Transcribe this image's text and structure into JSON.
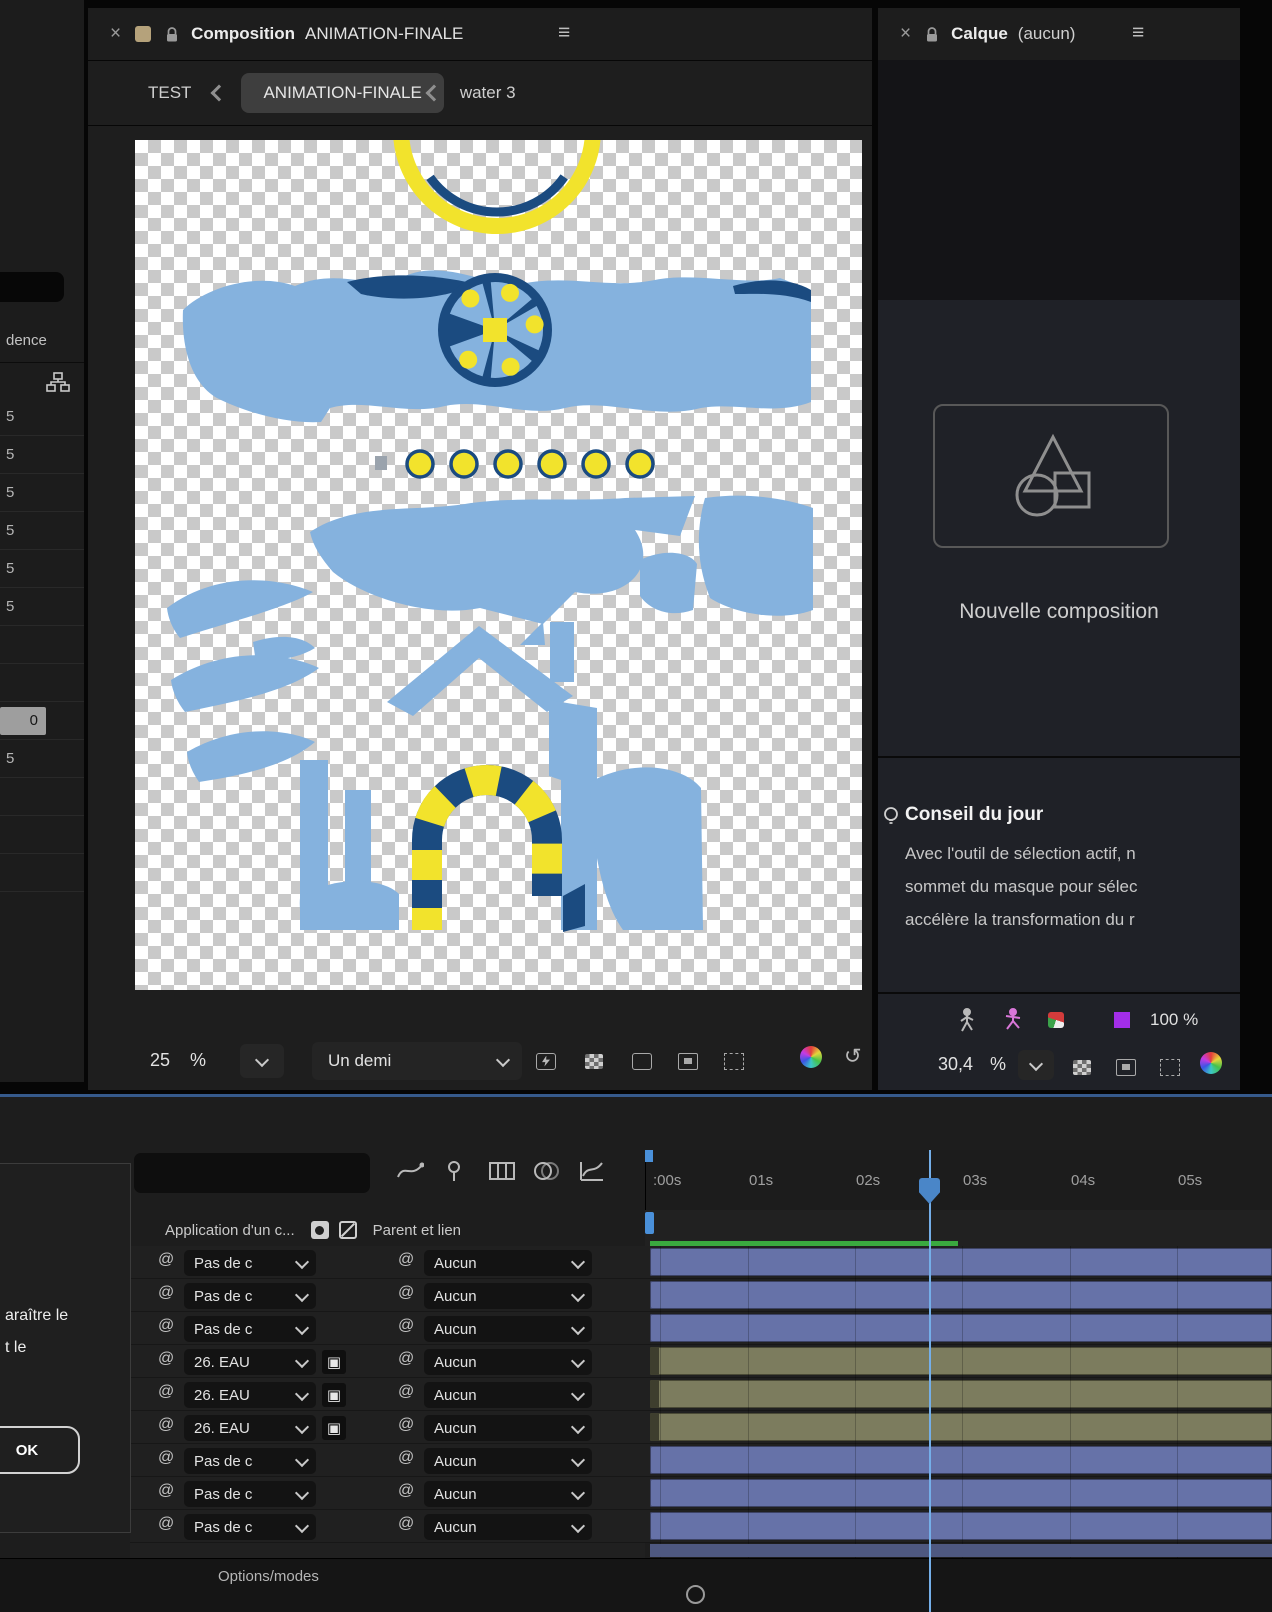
{
  "colors": {
    "art-blue": "#85b2de",
    "art-dark": "#1b4b80",
    "art-yellow": "#f2e32c",
    "bar-blue": "#6672a8",
    "bar-olive": "#7c7c5e",
    "cache-green": "#3aa93f",
    "playhead-blue": "#4a86c8",
    "accent-tan": "#b5a27b"
  },
  "left_strip": {
    "tab_label": "dence",
    "rows": [
      {
        "label": "5"
      },
      {
        "label": "5"
      },
      {
        "label": "5"
      },
      {
        "label": "5"
      },
      {
        "label": "5"
      },
      {
        "label": "5"
      },
      {
        "label": ""
      },
      {
        "label": ""
      },
      {
        "label": "0",
        "highlight": true
      },
      {
        "label": "5"
      },
      {
        "label": ""
      },
      {
        "label": ""
      },
      {
        "label": ""
      }
    ]
  },
  "composition_panel": {
    "tab": {
      "close": "×",
      "title": "Composition",
      "name": "ANIMATION-FINALE",
      "menu": "≡"
    },
    "breadcrumb": {
      "items": [
        "TEST",
        "ANIMATION-FINALE",
        "water 3"
      ]
    },
    "toolbar": {
      "zoom_value": "25",
      "percent": "%",
      "resolution": "Un demi"
    }
  },
  "layer_panel": {
    "tab": {
      "close": "×",
      "title": "Calque",
      "subtitle": "(aucun)",
      "menu": "≡"
    },
    "empty_label": "Nouvelle composition",
    "tip": {
      "heading": "Conseil du jour",
      "lines": [
        "Avec l'outil de sélection actif, n",
        "sommet du masque pour sélec",
        "accélère la transformation du r"
      ]
    },
    "toolbar": {
      "zoom_value": "30,4",
      "percent": "%",
      "preview_zoom": "100 %"
    }
  },
  "dialog": {
    "lines": [
      "araître le",
      "t le"
    ],
    "ok_label": "OK"
  },
  "timeline": {
    "columns": {
      "source": "Application d'un c...",
      "parent": "Parent et lien"
    },
    "ruler_labels": [
      ":00s",
      "01s",
      "02s",
      "03s",
      "04s",
      "05s"
    ],
    "rows": [
      {
        "matte": "Pas de c",
        "parent": "Aucun",
        "bar": "blue",
        "matte_icon": false
      },
      {
        "matte": "Pas de c",
        "parent": "Aucun",
        "bar": "blue",
        "matte_icon": false
      },
      {
        "matte": "Pas de c",
        "parent": "Aucun",
        "bar": "blue",
        "matte_icon": false
      },
      {
        "matte": "26. EAU",
        "parent": "Aucun",
        "bar": "olive",
        "matte_icon": true
      },
      {
        "matte": "26. EAU",
        "parent": "Aucun",
        "bar": "olive",
        "matte_icon": true
      },
      {
        "matte": "26. EAU",
        "parent": "Aucun",
        "bar": "olive",
        "matte_icon": true
      },
      {
        "matte": "Pas de c",
        "parent": "Aucun",
        "bar": "blue",
        "matte_icon": false
      },
      {
        "matte": "Pas de c",
        "parent": "Aucun",
        "bar": "blue",
        "matte_icon": false
      },
      {
        "matte": "Pas de c",
        "parent": "Aucun",
        "bar": "blue",
        "matte_icon": false
      }
    ],
    "footer": "Options/modes"
  }
}
